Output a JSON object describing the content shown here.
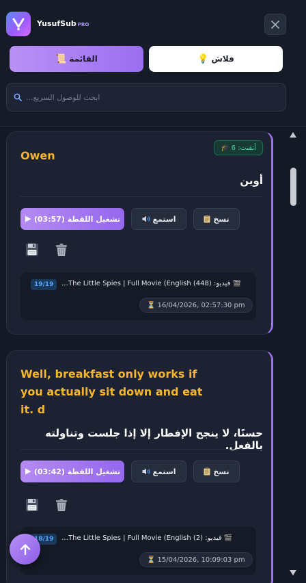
{
  "header": {
    "brand": "YusufSub",
    "pro": "PRO",
    "tabs": [
      {
        "label": "القائمة",
        "icon": "📜"
      },
      {
        "label": "فلاش",
        "icon": "💡"
      }
    ],
    "search": {
      "placeholder": "ابحث للوصول السريع...",
      "icon": "search-icon"
    }
  },
  "cards": [
    {
      "badge_text": "أتقنت: 6",
      "badge_icon": "🎓",
      "english": "Owen",
      "arabic": "أوين",
      "buttons": {
        "play": "تشغيل اللقطة (03:57)",
        "listen": "استمع",
        "copy": "نسخ"
      },
      "source": {
        "episode": "19/19",
        "video_label": "فيديو:",
        "video_title": "(448) The Little Spies | Full Movie (English…",
        "timestamp": "16/04/2026, 02:57:30 pm"
      }
    },
    {
      "english": "Well, breakfast only works if you actually sit down and eat it. d",
      "arabic": "حسنًا، لا ينجح الإفطار إلا إذا جلست وتناولته بالفعل.",
      "buttons": {
        "play": "تشغيل اللقطة (03:42)",
        "listen": "استمع",
        "copy": "نسخ"
      },
      "source": {
        "episode": "18/19",
        "video_label": "فيديو:",
        "video_title": "(2) The Little Spies | Full Movie (English…",
        "timestamp": "15/04/2026, 10:09:03 pm"
      }
    }
  ],
  "colors": {
    "accent": "#9e72ef",
    "english_text": "#f5b52c",
    "success": "#3fd5a0"
  }
}
